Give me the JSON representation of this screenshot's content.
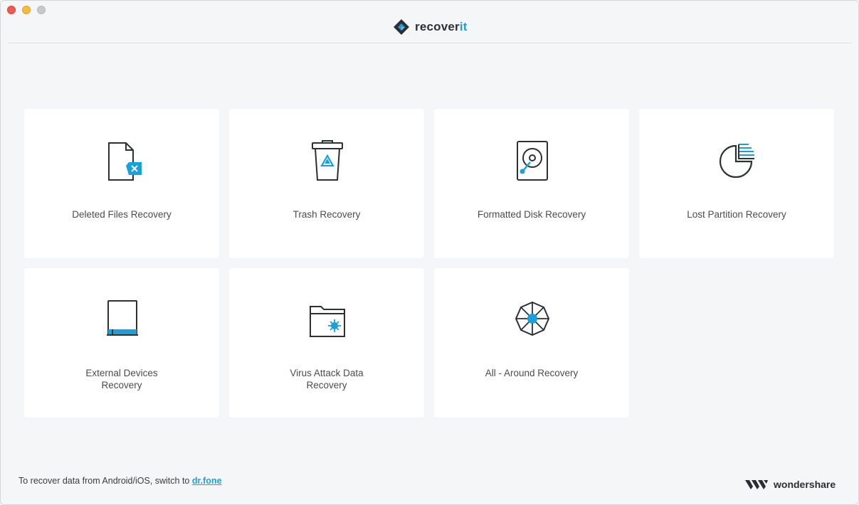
{
  "app": {
    "logo_word": "recover",
    "logo_suffix": "it"
  },
  "cards": [
    {
      "label": "Deleted Files Recovery",
      "icon": "deleted-file-icon"
    },
    {
      "label": "Trash Recovery",
      "icon": "trash-icon"
    },
    {
      "label": "Formatted Disk Recovery",
      "icon": "hard-disk-icon"
    },
    {
      "label": "Lost Partition Recovery",
      "icon": "partition-pie-icon"
    },
    {
      "label_line1": "External Devices",
      "label_line2": "Recovery",
      "icon": "external-device-icon"
    },
    {
      "label_line1": "Virus Attack Data",
      "label_line2": "Recovery",
      "icon": "virus-folder-icon"
    },
    {
      "label": "All - Around Recovery",
      "icon": "all-around-icon"
    }
  ],
  "footer": {
    "text": "To recover data from Android/iOS, switch to ",
    "link": "dr.fone"
  },
  "brand": {
    "name": "wondershare"
  },
  "colors": {
    "accent": "#1aa0dc",
    "icon_stroke": "#2c2f36"
  }
}
